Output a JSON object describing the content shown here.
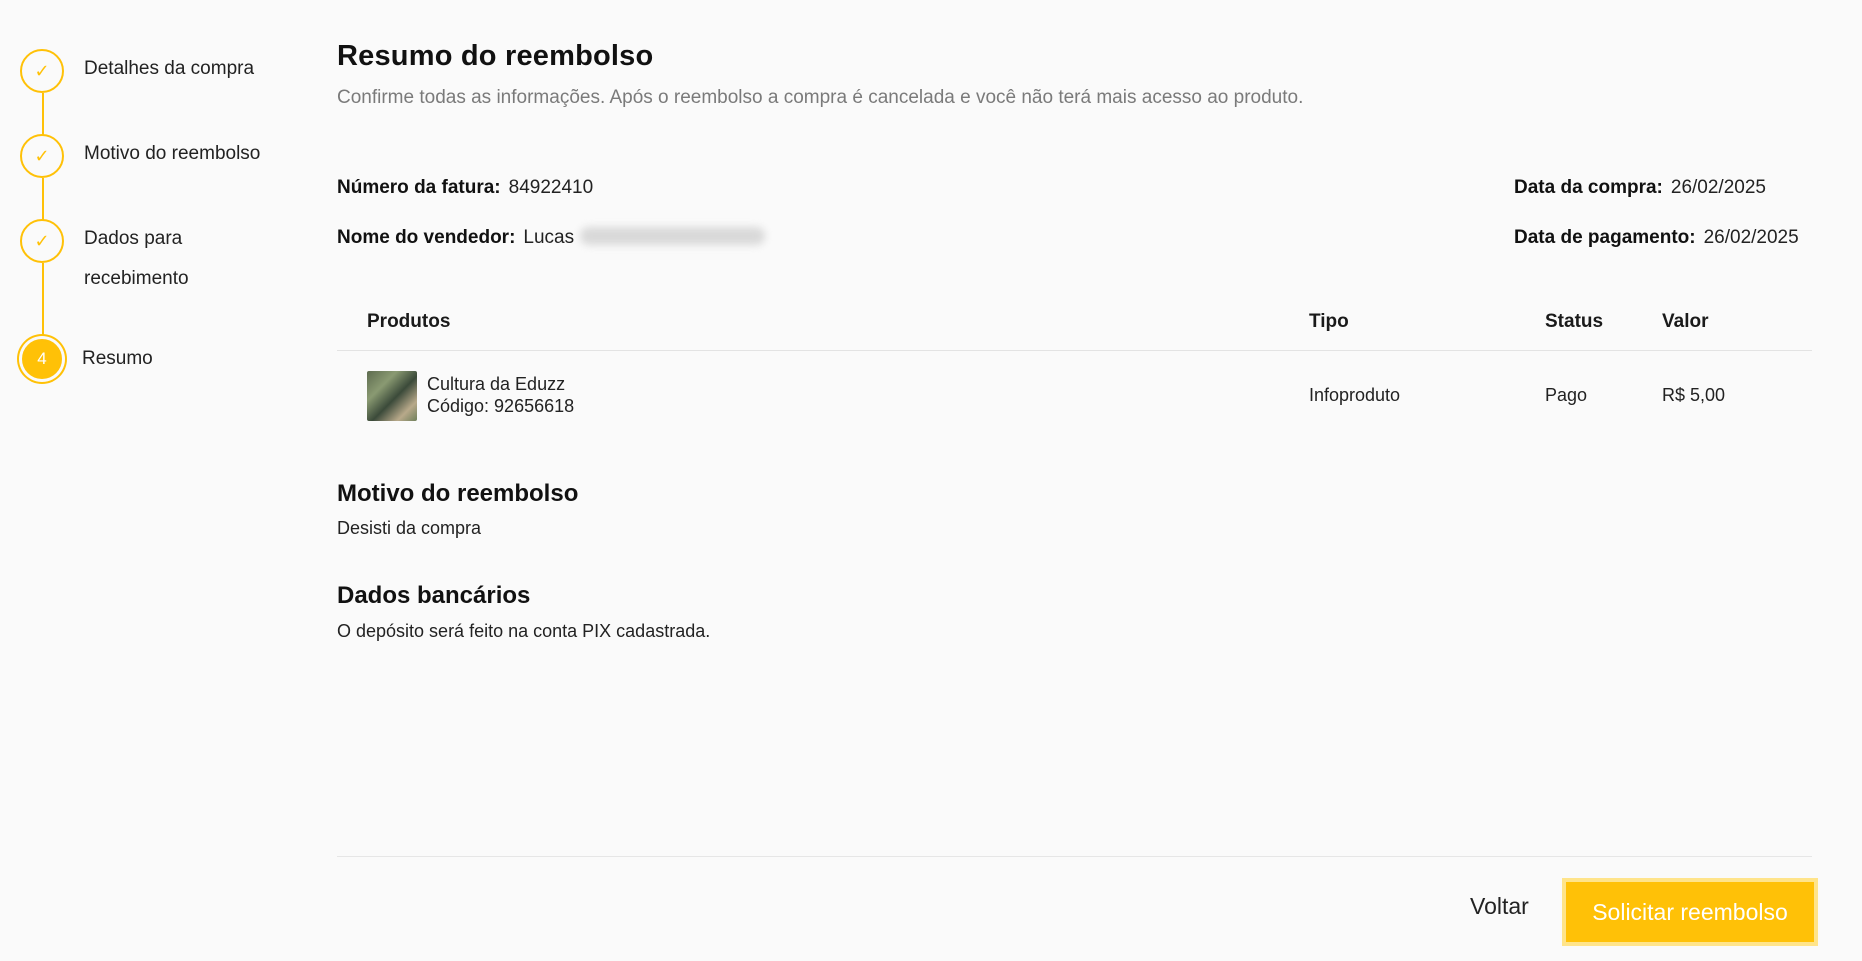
{
  "stepper": {
    "steps": [
      {
        "label": "Detalhes da compra",
        "marker": "✓"
      },
      {
        "label": "Motivo do reembolso",
        "marker": "✓"
      },
      {
        "label": "Dados para recebimento",
        "marker": "✓"
      },
      {
        "label": "Resumo",
        "marker": "4"
      }
    ],
    "colors": {
      "accent": "#ffc107"
    }
  },
  "header": {
    "title": "Resumo do reembolso",
    "subtitle": "Confirme todas as informações. Após o reembolso a compra é cancelada e você não terá mais acesso ao produto."
  },
  "info": {
    "invoice_label": "Número da fatura:",
    "invoice_value": "84922410",
    "seller_label": "Nome do vendedor:",
    "seller_value": "Lucas",
    "purchase_date_label": "Data da compra:",
    "purchase_date_value": "26/02/2025",
    "payment_date_label": "Data de pagamento:",
    "payment_date_value": "26/02/2025"
  },
  "products": {
    "columns": [
      "Produtos",
      "Tipo",
      "Status",
      "Valor"
    ],
    "rows": [
      {
        "name": "Cultura da Eduzz",
        "code": "Código: 92656618",
        "type": "Infoproduto",
        "status": "Pago",
        "value": "R$ 5,00"
      }
    ]
  },
  "reason": {
    "title": "Motivo do reembolso",
    "text": "Desisti da compra"
  },
  "bank": {
    "title": "Dados bancários",
    "text": "O depósito será feito na conta PIX cadastrada."
  },
  "footer": {
    "back_label": "Voltar",
    "submit_label": "Solicitar reembolso"
  }
}
